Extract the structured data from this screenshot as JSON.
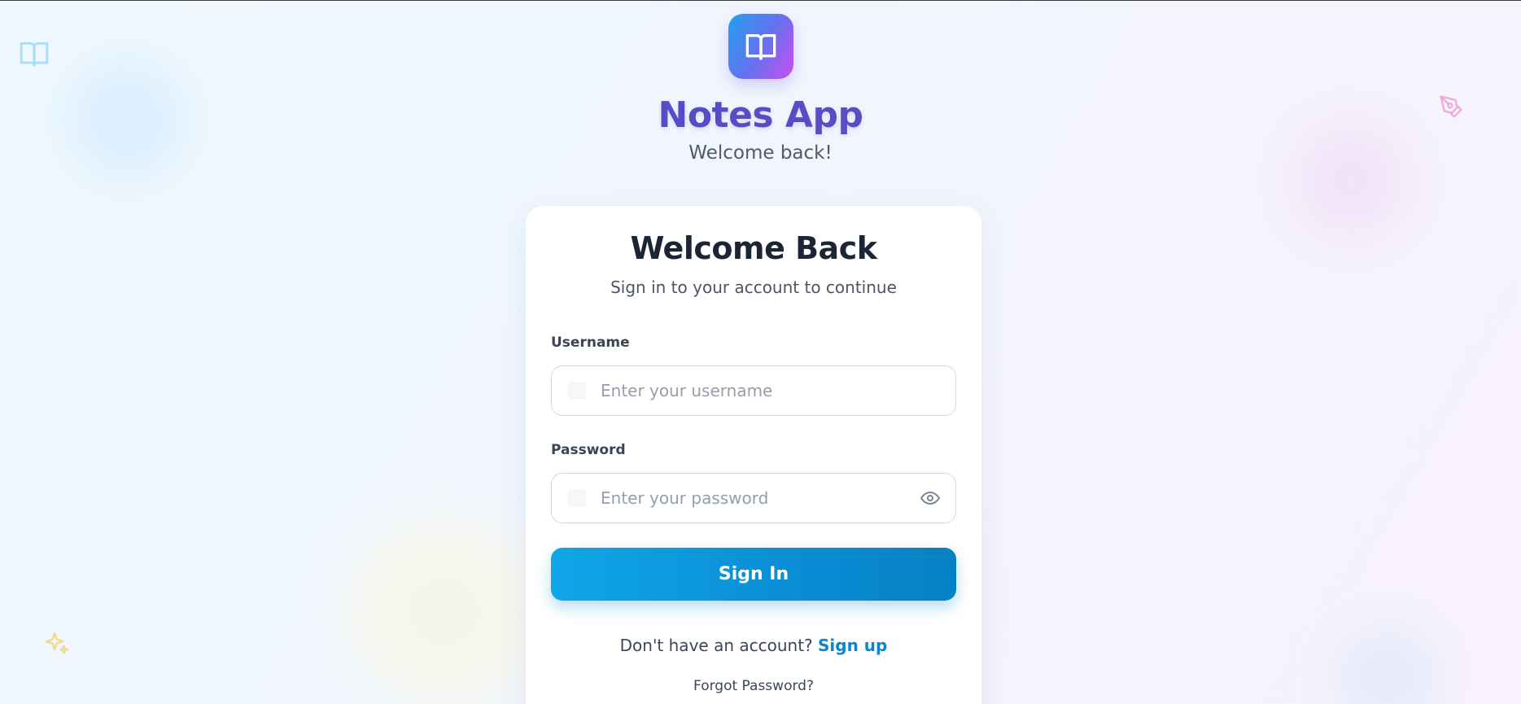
{
  "brand": {
    "app_name": "Notes App",
    "tagline": "Welcome back!",
    "logo_icon": "book-open-icon",
    "gradient_colors": [
      "#22a0ee",
      "#6a6ef0",
      "#cc4fef"
    ]
  },
  "decorations": {
    "top_left_icon": "book-open-icon",
    "top_right_icon": "pen-nib-icon",
    "bottom_left_icon": "sparkles-icon"
  },
  "login_card": {
    "title": "Welcome Back",
    "subtitle": "Sign in to your account to continue",
    "username": {
      "label": "Username",
      "placeholder": "Enter your username",
      "value": "",
      "icon": "user-icon"
    },
    "password": {
      "label": "Password",
      "placeholder": "Enter your password",
      "value": "",
      "icon": "lock-icon",
      "toggle_icon": "eye-icon"
    },
    "submit_label": "Sign In",
    "signup_prompt": "Don't have an account?",
    "signup_link": "Sign up",
    "forgot_link": "Forgot Password?"
  },
  "colors": {
    "accent": "#0b86c9",
    "button_start": "#10a6e8",
    "button_end": "#0680c4",
    "title": "#1b2535"
  }
}
